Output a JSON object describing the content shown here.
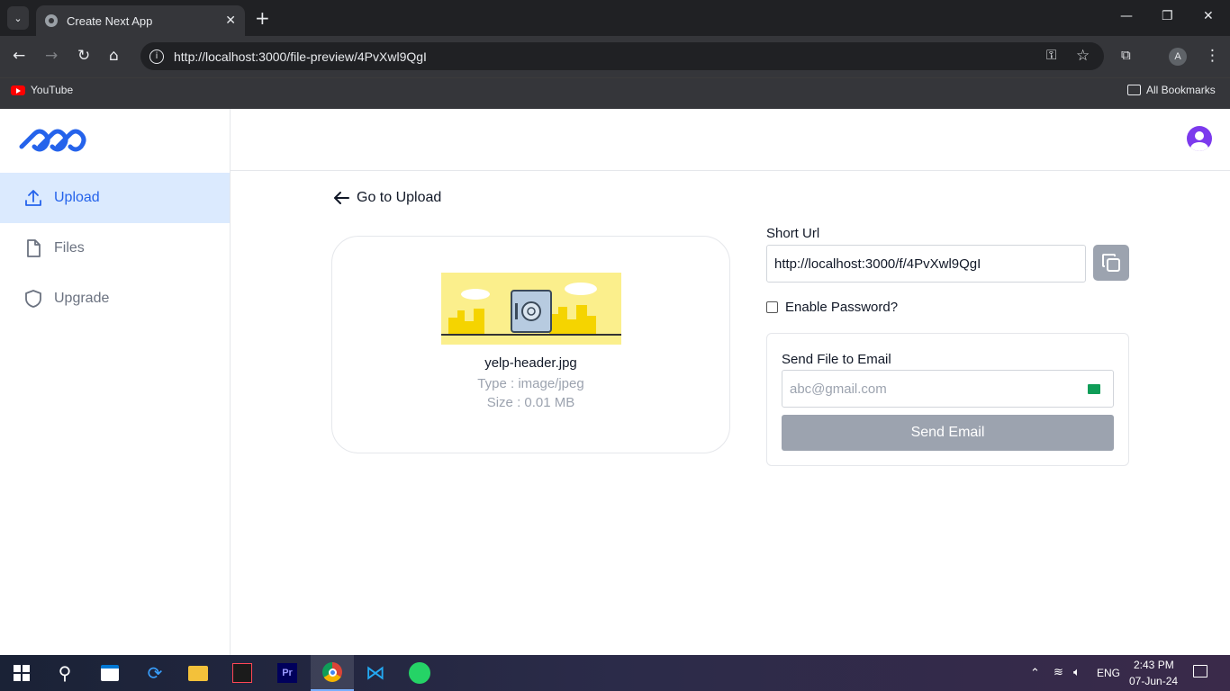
{
  "browser": {
    "tab_title": "Create Next App",
    "url": "http://localhost:3000/file-preview/4PvXwl9QgI",
    "bookmarks": [
      {
        "label": "YouTube"
      },
      {
        "label": "All Bookmarks"
      }
    ],
    "profile_initial": "A"
  },
  "sidebar": {
    "items": [
      {
        "label": "Upload",
        "active": true
      },
      {
        "label": "Files",
        "active": false
      },
      {
        "label": "Upgrade",
        "active": false
      }
    ]
  },
  "main": {
    "back_label": "Go to Upload",
    "file": {
      "name": "yelp-header.jpg",
      "type_text": "Type : image/jpeg",
      "size_text": "Size : 0.01 MB"
    },
    "short_url_label": "Short Url",
    "short_url_value": "http://localhost:3000/f/4PvXwl9QgI",
    "enable_password_label": "Enable Password?",
    "send_email": {
      "title": "Send File to Email",
      "placeholder": "abc@gmail.com",
      "button_label": "Send Email"
    }
  },
  "taskbar": {
    "language": "ENG",
    "time": "2:43 PM",
    "date": "07-Jun-24"
  },
  "colors": {
    "accent": "#2563eb",
    "active_bg": "#dbeafe",
    "button_gray": "#9ca3af",
    "avatar": "#7c3aed"
  }
}
